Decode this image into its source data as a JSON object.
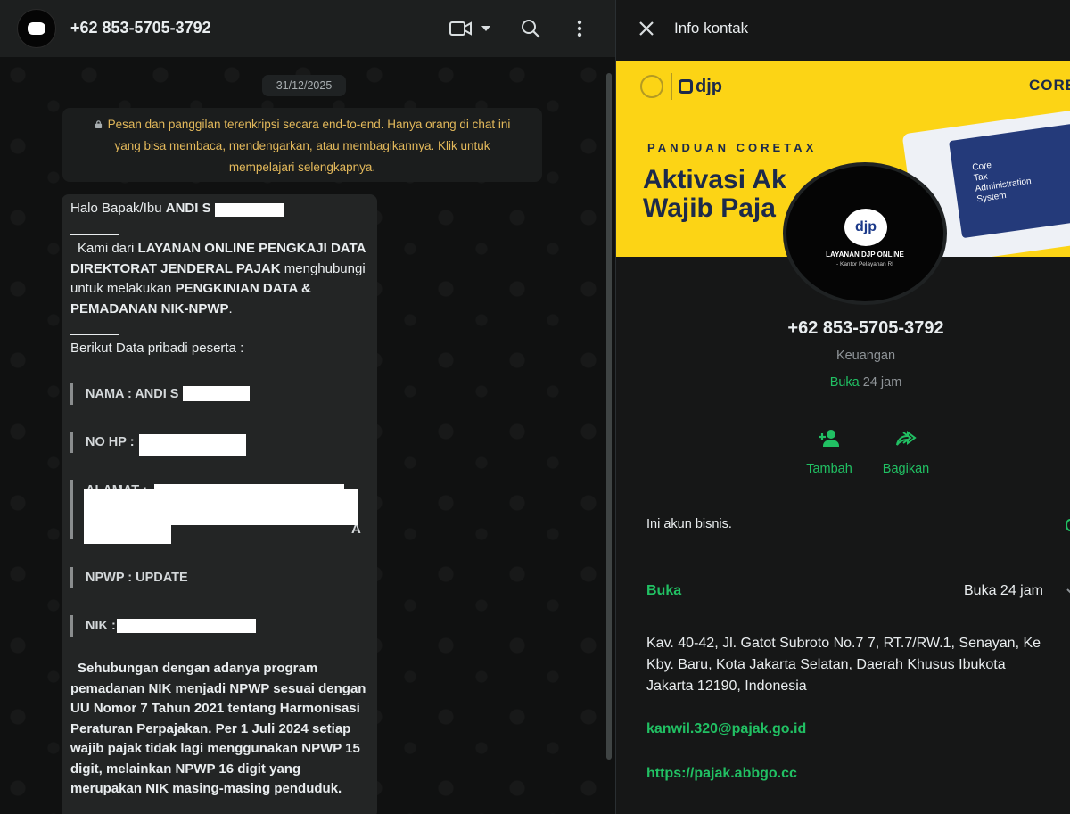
{
  "chat": {
    "title": "+62 853-5705-3792",
    "date": "31/12/2025",
    "encryption_notice": "Pesan dan panggilan terenkripsi secara end-to-end. Hanya orang di chat ini yang bisa membaca, mendengarkan, atau membagikannya. Klik untuk mempelajari selengkapnya.",
    "message": {
      "greeting_prefix": "Halo Bapak/Ibu ",
      "greeting_name": "ANDI S",
      "intro_1": "Kami dari ",
      "intro_bold_1": "LAYANAN ONLINE PENGKAJI DATA DIREKTORAT JENDERAL PAJAK",
      "intro_2": " menghubungi untuk melakukan ",
      "intro_bold_2": "PENGKINIAN DATA & PEMADANAN NIK-NPWP",
      "intro_3": ".",
      "data_heading": "Berikut Data pribadi peserta :",
      "field_nama": "NAMA : ANDI S",
      "field_nohp": "NO HP : ",
      "field_alamat_1": "ALAMAT : ",
      "field_alamat_tail": "A",
      "field_npwp": "NPWP : UPDATE",
      "field_nik": "NIK : ",
      "closing": "Sehubungan dengan adanya program pemadanan NIK menjadi NPWP sesuai dengan UU Nomor 7 Tahun 2021 tentang Harmonisasi Peraturan Perpajakan. Per 1 Juli 2024 setiap wajib pajak tidak lagi menggunakan NPWP 15 digit, melainkan NPWP 16 digit yang merupakan NIK masing-masing penduduk."
    }
  },
  "info": {
    "title": "Info kontak",
    "banner": {
      "djp": "djp",
      "coretax": "CORET",
      "panduan": "PANDUAN CORETAX",
      "headline_1": "Aktivasi Ak",
      "headline_2": "Wajib Paja",
      "screen_text": "Core\nTax\nAdministration\nSystem"
    },
    "profile_caption_1": "LAYANAN DJP ONLINE",
    "profile_caption_2": "- Kantor Pelayanan RI",
    "profile_logo": "djp",
    "phone": "+62 853-5705-3792",
    "category": "Keuangan",
    "hours_open": "Buka",
    "hours_span": " 24 jam",
    "actions": [
      {
        "label": "Tambah",
        "icon": "add-contact-icon"
      },
      {
        "label": "Bagikan",
        "icon": "share-icon"
      }
    ],
    "business_note": "Ini akun bisnis.",
    "hours_label": "Buka",
    "hours_value": "Buka 24 jam",
    "address": "Kav. 40-42, Jl. Gatot Subroto No.7 7, RT.7/RW.1, Senayan, Ke\nKby. Baru, Kota Jakarta Selatan, Daerah Khusus Ibukota\nJakarta 12190, Indonesia",
    "email": "kanwil.320@pajak.go.id",
    "website": "https://pajak.abbgo.cc"
  },
  "colors": {
    "accent_green": "#21c063",
    "notice_yellow": "#e3b95b",
    "banner_yellow": "#fcd415"
  }
}
